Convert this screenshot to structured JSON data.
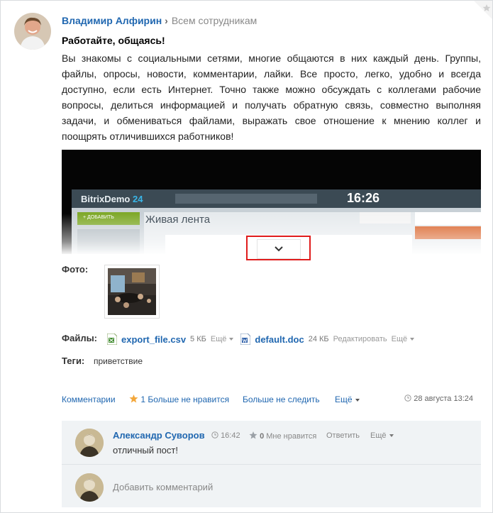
{
  "post": {
    "author": "Владимир Алфирин",
    "recipients": "Всем сотрудникам",
    "title": "Работайте, общаясь!",
    "body": "Вы знакомы с социальными сетями, многие общаются в них каждый день. Группы, файлы, опросы, новости, комментарии, лайки. Все просто, легко, удобно и всегда доступно, если есть Интернет. Точно также можно обсуждать с коллегами рабочие вопросы, делиться информацией и получать обратную связь, совместно выполняя задачи, и обмениваться файлами, выражать свое отношение к мнению коллег и поощрять отличившихся работников!"
  },
  "video_preview": {
    "brand": "BitrixDemo",
    "brand_num": "24",
    "clock": "16:26",
    "page_heading": "Живая лента",
    "add_button": "+ ДОБАВИТЬ"
  },
  "labels": {
    "photo": "Фото:",
    "files": "Файлы:",
    "tags": "Теги:"
  },
  "files": [
    {
      "name": "export_file.csv",
      "size": "5 КБ",
      "more": "Ещё"
    },
    {
      "name": "default.doc",
      "size": "24 КБ",
      "edit": "Редактировать",
      "more": "Ещё"
    }
  ],
  "tags": "приветствие",
  "actions": {
    "comments": "Комментарии",
    "like_count": "1",
    "unlike": "Больше не нравится",
    "unfollow": "Больше не следить",
    "more": "Ещё",
    "date": "28 августа 13:24"
  },
  "comment": {
    "author": "Александр Суворов",
    "time": "16:42",
    "like_count": "0",
    "like": "Мне нравится",
    "reply": "Ответить",
    "more": "Ещё",
    "text": "отличный пост!"
  },
  "add_comment_placeholder": "Добавить комментарий",
  "colors": {
    "link": "#2067b0",
    "star": "#f3a73b",
    "highlight_border": "#e01c1c",
    "comments_bg": "#f0f3f5"
  }
}
